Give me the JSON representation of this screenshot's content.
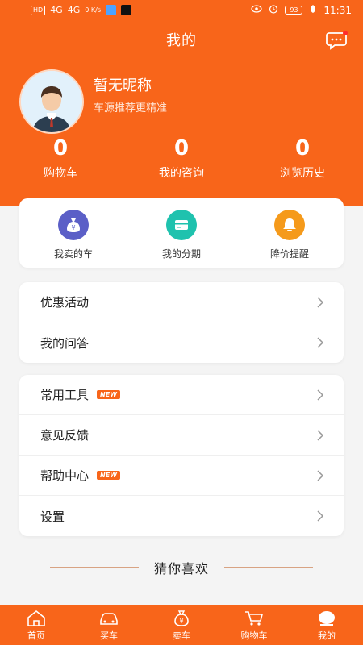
{
  "status_bar": {
    "network": "HD",
    "signal_a": "4G",
    "signal_b": "4G",
    "speed": "0 K/s",
    "battery": "93",
    "time": "11:31"
  },
  "header": {
    "title": "我的",
    "message_icon": "chat-bubble-icon"
  },
  "profile": {
    "nickname": "暂无昵称",
    "subtitle": "车源推荐更精准"
  },
  "stats": [
    {
      "value": "0",
      "label": "购物车"
    },
    {
      "value": "0",
      "label": "我的咨询"
    },
    {
      "value": "0",
      "label": "浏览历史"
    }
  ],
  "quick_actions": [
    {
      "label": "我卖的车",
      "icon": "money-bag-icon",
      "color": "#5b5fc7"
    },
    {
      "label": "我的分期",
      "icon": "credit-card-icon",
      "color": "#1fc2ae"
    },
    {
      "label": "降价提醒",
      "icon": "bell-icon",
      "color": "#f59a1b"
    }
  ],
  "menu_group_1": [
    {
      "label": "优惠活动"
    },
    {
      "label": "我的问答"
    }
  ],
  "menu_group_2": [
    {
      "label": "常用工具",
      "badge": "NEW"
    },
    {
      "label": "意见反馈"
    },
    {
      "label": "帮助中心",
      "badge": "NEW"
    },
    {
      "label": "设置"
    }
  ],
  "section_title": "猜你喜欢",
  "tabbar": [
    {
      "label": "首页",
      "icon": "home-icon"
    },
    {
      "label": "买车",
      "icon": "car-icon"
    },
    {
      "label": "卖车",
      "icon": "money-bag-icon"
    },
    {
      "label": "购物车",
      "icon": "cart-icon"
    },
    {
      "label": "我的",
      "icon": "profile-icon"
    }
  ],
  "colors": {
    "brand": "#f8651a",
    "background": "#f4f4f4"
  }
}
